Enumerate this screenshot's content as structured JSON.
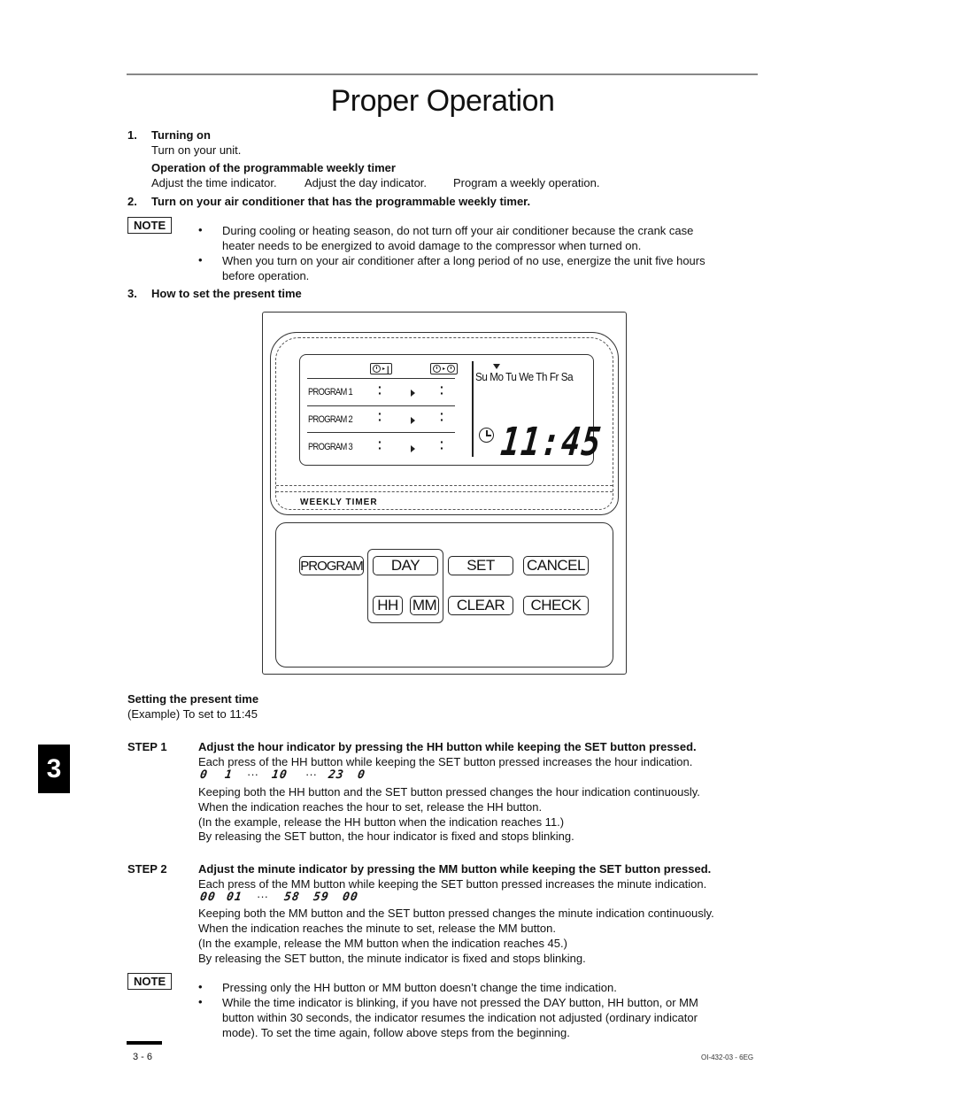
{
  "page": {
    "title": "Proper Operation",
    "chapter_tab": "3",
    "footer_page": "3 - 6",
    "footer_code": "OI-432-03 - 6EG"
  },
  "section1": {
    "number": "1.",
    "heading": "Turning on",
    "text": "Turn on your unit.",
    "subheading": "Operation of the programmable weekly timer",
    "steps": [
      "Adjust the time indicator.",
      "Adjust the day indicator.",
      "Program a weekly operation."
    ]
  },
  "section2": {
    "number": "2.",
    "heading": "Turn on your air conditioner that has the programmable weekly timer."
  },
  "note1": {
    "label": "NOTE",
    "bullets": [
      "During cooling or heating season, do not turn off your air conditioner because the crank case",
      "heater needs to be energized to avoid damage to the compressor when turned on.",
      "When you turn on your air conditioner after a long period of no use, energize the unit five hours",
      "before operation."
    ]
  },
  "section3": {
    "number": "3.",
    "heading": "How to set the present time"
  },
  "remote": {
    "programs": [
      "PROGRAM 1",
      "PROGRAM 2",
      "PROGRAM 3"
    ],
    "days": "Su Mo Tu We Th Fr Sa",
    "selected_day": "Mo",
    "time": "11:45",
    "panel_label": "WEEKLY TIMER",
    "buttons": {
      "program": "PROGRAM",
      "day": "DAY",
      "set": "SET",
      "cancel": "CANCEL",
      "hh": "HH",
      "mm": "MM",
      "clear": "CLEAR",
      "check": "CHECK"
    }
  },
  "setting": {
    "heading": "Setting the present time",
    "example": "(Example) To set to 11:45"
  },
  "step1": {
    "label": "STEP 1",
    "heading": "Adjust the hour indicator by pressing the HH button while keeping the SET button pressed.",
    "lines": [
      "Each press of the HH button while keeping the SET button pressed increases the hour indication.",
      "Keeping both the HH button and the SET button pressed changes the hour indication continuously.",
      "When the indication reaches the hour to set, release the HH button.",
      "(In the example, release the HH button when the indication reaches 11.)",
      "By releasing the SET button, the hour indicator is fixed and stops blinking."
    ],
    "sequence": [
      "0",
      "1",
      "···",
      "10",
      "···",
      "23",
      "0"
    ]
  },
  "step2": {
    "label": "STEP 2",
    "heading": "Adjust the minute indicator by pressing the MM button while keeping the SET button pressed.",
    "lines": [
      "Each press of the MM button while keeping the SET button pressed increases the minute indication.",
      "Keeping both the MM button and the SET button pressed changes the minute indication continuously.",
      "When the indication reaches the minute to set, release the MM button.",
      "(In the example, release the MM button when the indication reaches 45.)",
      "By releasing the SET button, the minute indicator is fixed and stops blinking."
    ],
    "sequence": [
      "00",
      "01",
      "···",
      "58",
      "59",
      "00"
    ]
  },
  "note2": {
    "label": "NOTE",
    "bullets": [
      "Pressing only the HH button or MM button doesn’t change the time indication.",
      "While the time indicator is blinking, if you have not pressed the DAY button, HH button, or MM",
      "button within 30 seconds, the indicator resumes the indication not adjusted (ordinary indicator",
      "mode). To set the time again, follow above steps from the beginning."
    ]
  }
}
